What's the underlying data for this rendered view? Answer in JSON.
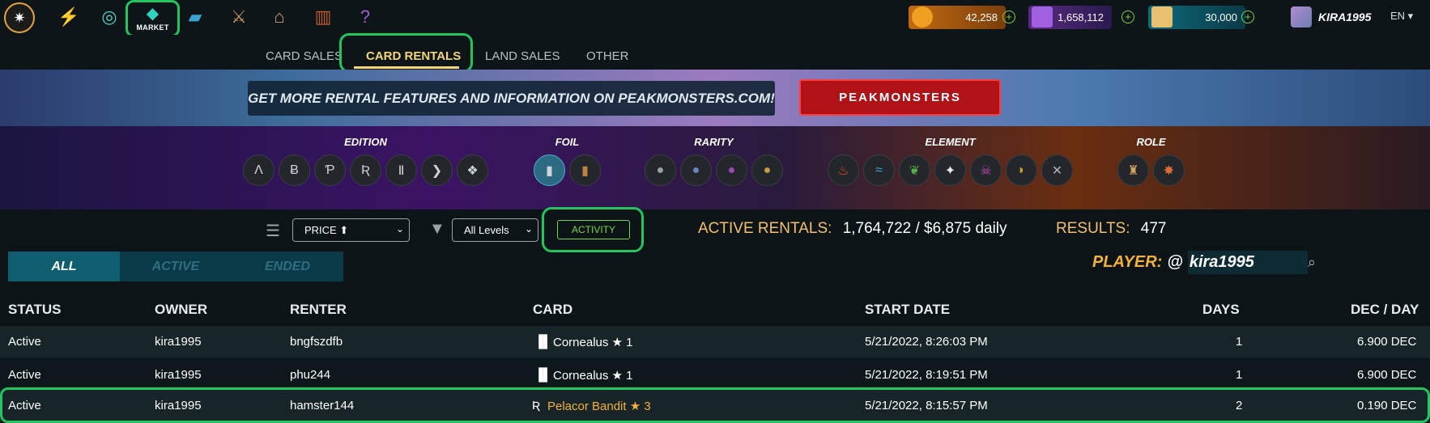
{
  "topbar": {
    "market_label": "MARKET",
    "currencies": [
      {
        "name": "dec",
        "value": "42,258",
        "color": "#c26a12"
      },
      {
        "name": "sps",
        "value": "1,658,112",
        "color": "#5a2a80"
      },
      {
        "name": "credits",
        "value": "30,000",
        "color": "#0e6a7a"
      }
    ],
    "username": "KIRA1995",
    "language": "EN"
  },
  "tabs": {
    "items": [
      "CARD SALES",
      "CARD RENTALS",
      "LAND SALES",
      "OTHER"
    ],
    "active": "CARD RENTALS"
  },
  "banner": {
    "message": "GET MORE RENTAL FEATURES AND INFORMATION ON PEAKMONSTERS.COM!",
    "button": "PEAKMONSTERS"
  },
  "filters": {
    "edition": "EDITION",
    "foil": "FOIL",
    "rarity": "RARITY",
    "element": "ELEMENT",
    "role": "ROLE"
  },
  "toolbar": {
    "sort": "PRICE ⬆",
    "levels": "All Levels",
    "activity": "ACTIVITY",
    "active_rentals_label": "ACTIVE RENTALS:",
    "active_rentals_value": "1,764,722 / $6,875 daily",
    "results_label": "RESULTS:",
    "results_value": "477"
  },
  "subtabs": [
    "ALL",
    "ACTIVE",
    "ENDED"
  ],
  "player": {
    "label": "PLAYER:",
    "at": "@",
    "value": "kira1995"
  },
  "table": {
    "headers": [
      "STATUS",
      "OWNER",
      "RENTER",
      "CARD",
      "START DATE",
      "DAYS",
      "DEC / DAY"
    ],
    "rows": [
      {
        "status": "Active",
        "owner": "kira1995",
        "renter": "bngfszdfb",
        "card": "Cornealus ★ 1",
        "date": "5/21/2022, 8:26:03 PM",
        "days": "1",
        "dec": "6.900 DEC"
      },
      {
        "status": "Active",
        "owner": "kira1995",
        "renter": "phu244",
        "card": "Cornealus ★ 1",
        "date": "5/21/2022, 8:19:51 PM",
        "days": "1",
        "dec": "6.900 DEC"
      },
      {
        "status": "Active",
        "owner": "kira1995",
        "renter": "hamster144",
        "card": "Pelacor Bandit ★ 3",
        "date": "5/21/2022, 8:15:57 PM",
        "days": "2",
        "dec": "0.190 DEC"
      }
    ]
  }
}
